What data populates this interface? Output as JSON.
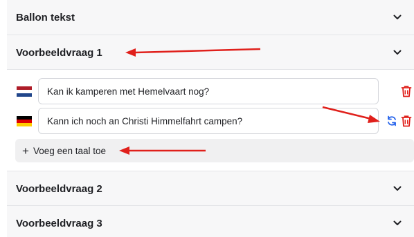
{
  "sections": {
    "ballon": {
      "label": "Ballon tekst"
    },
    "v1": {
      "label": "Voorbeeldvraag 1"
    },
    "v2": {
      "label": "Voorbeeldvraag 2"
    },
    "v3": {
      "label": "Voorbeeldvraag 3"
    }
  },
  "translations": [
    {
      "flag": "nl-flag-icon",
      "value": "Kan ik kamperen met Hemelvaart nog?"
    },
    {
      "flag": "de-flag-icon",
      "value": "Kann ich noch an Christi Himmelfahrt campen?"
    }
  ],
  "add_language": {
    "plus": "+",
    "label": "Voeg een taal toe"
  },
  "colors": {
    "annotation_arrow": "#e0201b",
    "delete_icon": "#e0201b",
    "refresh_icon": "#2563eb"
  }
}
